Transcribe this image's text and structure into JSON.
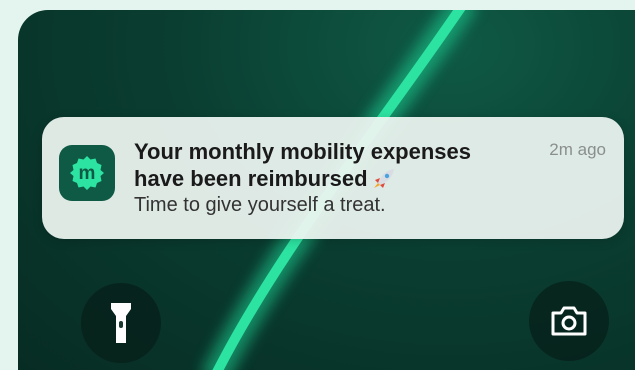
{
  "notification": {
    "title_line1": "Your monthly mobility expenses",
    "title_line2": "have been reimbursed",
    "body": "Time to give yourself a treat.",
    "time": "2m ago",
    "app_icon_letter": "m",
    "emoji_icon": "rocket-icon"
  },
  "controls": {
    "flashlight_icon": "flashlight-icon",
    "camera_icon": "camera-icon"
  },
  "colors": {
    "wallpaper": "#0a3e31",
    "accent_stripe": "#2de3a2",
    "app_icon_bg": "#0e5a44",
    "app_icon_badge": "#2de3a2"
  }
}
